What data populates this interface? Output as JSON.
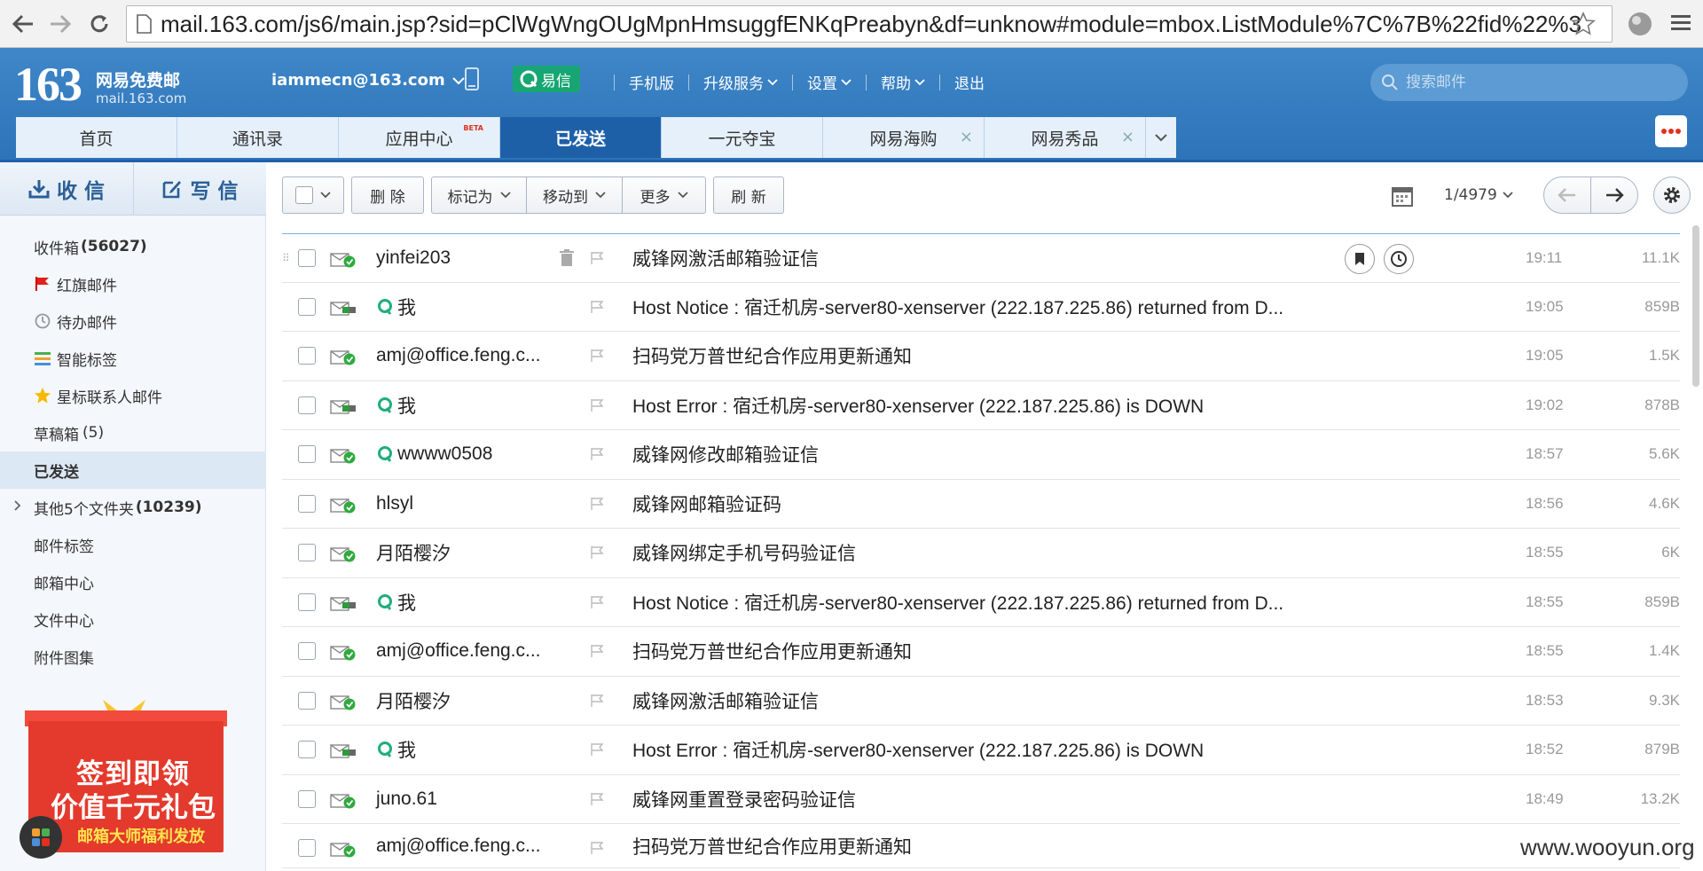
{
  "browser": {
    "url": "mail.163.com/js6/main.jsp?sid=pClWgWngOUgMpnHmsuggfENKqPreabyn&df=unknow#module=mbox.ListModule%7C%7B%22fid%22%3"
  },
  "header": {
    "logo_number": "163",
    "logo_cn": "网易免费邮",
    "logo_domain": "mail.163.com",
    "account": "iammecn@163.com",
    "yixin": "易信",
    "links": [
      "手机版",
      "升级服务",
      "设置",
      "帮助",
      "退出"
    ],
    "search_placeholder": "搜索邮件"
  },
  "tabs": [
    {
      "label": "首页"
    },
    {
      "label": "通讯录"
    },
    {
      "label": "应用中心",
      "badge": "BETA"
    },
    {
      "label": "已发送",
      "active": true
    },
    {
      "label": "一元夺宝"
    },
    {
      "label": "网易海购",
      "closable": true
    },
    {
      "label": "网易秀品",
      "closable": true
    }
  ],
  "sidebar": {
    "receive": "收 信",
    "compose": "写 信",
    "folders": [
      {
        "label": "收件箱",
        "count": "(56027)"
      },
      {
        "label": "红旗邮件"
      },
      {
        "label": "待办邮件"
      },
      {
        "label": "智能标签"
      },
      {
        "label": "星标联系人邮件"
      },
      {
        "label": "草稿箱",
        "count_plain": "(5)"
      },
      {
        "label": "已发送"
      },
      {
        "label": "其他5个文件夹",
        "count": "(10239)"
      },
      {
        "label": "邮件标签"
      },
      {
        "label": "邮箱中心"
      },
      {
        "label": "文件中心"
      },
      {
        "label": "附件图集"
      }
    ],
    "promo": {
      "line1": "签到即领",
      "line2": "价值千元礼包",
      "line3": "邮箱大师福利发放"
    }
  },
  "toolbar": {
    "delete": "删 除",
    "mark_as": "标记为",
    "move_to": "移动到",
    "more": "更多",
    "refresh": "刷 新",
    "pager": "1/4979"
  },
  "mails": [
    {
      "sender": "yinfei203",
      "subject": "威锋网激活邮箱验证信",
      "time": "19:11",
      "size": "11.1K"
    },
    {
      "sender": "我",
      "subject": "Host Notice : 宿迁机房-server80-xenserver (222.187.225.86) returned from D...",
      "time": "19:05",
      "size": "859B"
    },
    {
      "sender": "amj@office.feng.c...",
      "subject": "扫码党万普世纪合作应用更新通知",
      "time": "19:05",
      "size": "1.5K"
    },
    {
      "sender": "我",
      "subject": "Host Error : 宿迁机房-server80-xenserver (222.187.225.86) is DOWN",
      "time": "19:02",
      "size": "878B"
    },
    {
      "sender": "wwww0508",
      "subject": "威锋网修改邮箱验证信",
      "time": "18:57",
      "size": "5.6K"
    },
    {
      "sender": "hlsyl",
      "subject": "威锋网邮箱验证码",
      "time": "18:56",
      "size": "4.6K"
    },
    {
      "sender": "月陌樱汐",
      "subject": "威锋网绑定手机号码验证信",
      "time": "18:55",
      "size": "6K"
    },
    {
      "sender": "我",
      "subject": "Host Notice : 宿迁机房-server80-xenserver (222.187.225.86) returned from D...",
      "time": "18:55",
      "size": "859B"
    },
    {
      "sender": "amj@office.feng.c...",
      "subject": "扫码党万普世纪合作应用更新通知",
      "time": "18:55",
      "size": "1.4K"
    },
    {
      "sender": "月陌樱汐",
      "subject": "威锋网激活邮箱验证信",
      "time": "18:53",
      "size": "9.3K"
    },
    {
      "sender": "我",
      "subject": "Host Error : 宿迁机房-server80-xenserver (222.187.225.86) is DOWN",
      "time": "18:52",
      "size": "879B"
    },
    {
      "sender": "juno.61",
      "subject": "威锋网重置登录密码验证信",
      "time": "18:49",
      "size": "13.2K"
    },
    {
      "sender": "amj@office.feng.c...",
      "subject": "扫码党万普世纪合作应用更新通知",
      "time": "",
      "size": ""
    }
  ],
  "watermark": "www.wooyun.org"
}
